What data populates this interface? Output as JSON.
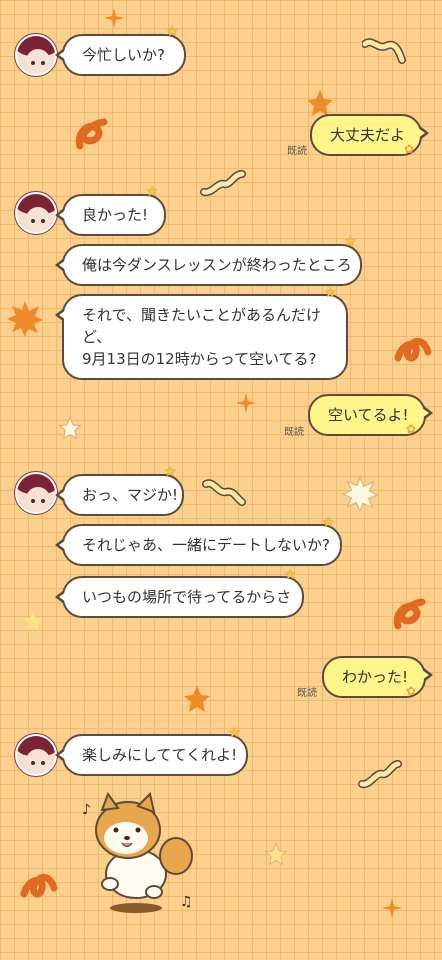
{
  "chat": {
    "read_label": "既読",
    "messages": [
      {
        "side": "left",
        "text": "今忙しいか?"
      },
      {
        "side": "right",
        "text": "大丈夫だよ"
      },
      {
        "side": "left",
        "text": "良かった!"
      },
      {
        "side": "left",
        "text": "俺は今ダンスレッスンが終わったところ"
      },
      {
        "side": "left",
        "lines": [
          "それで、聞きたいことがあるんだけど、",
          "9月13日の12時からって空いてる?"
        ]
      },
      {
        "side": "right",
        "text": "空いてるよ!"
      },
      {
        "side": "left",
        "text": "おっ、マジか!"
      },
      {
        "side": "left",
        "text": "それじゃあ、一緒にデートしないか?"
      },
      {
        "side": "left",
        "text": "いつもの場所で待ってるからさ"
      },
      {
        "side": "right",
        "text": "わかった!"
      },
      {
        "side": "left",
        "text": "楽しみにしててくれよ!"
      }
    ]
  },
  "colors": {
    "background": "#fbd08c",
    "grid": "#f1b86f",
    "bubble_left": "#ffffff",
    "bubble_right": "#fdf48a",
    "outline": "#5c4b3b",
    "deco_orange": "#f08a2a"
  },
  "icons": {
    "avatar": "character-avatar",
    "sticker": "dancing-dog-sticker",
    "decorations": [
      "sparkle-icon",
      "star-icon",
      "squiggle-icon",
      "burst-icon"
    ]
  }
}
